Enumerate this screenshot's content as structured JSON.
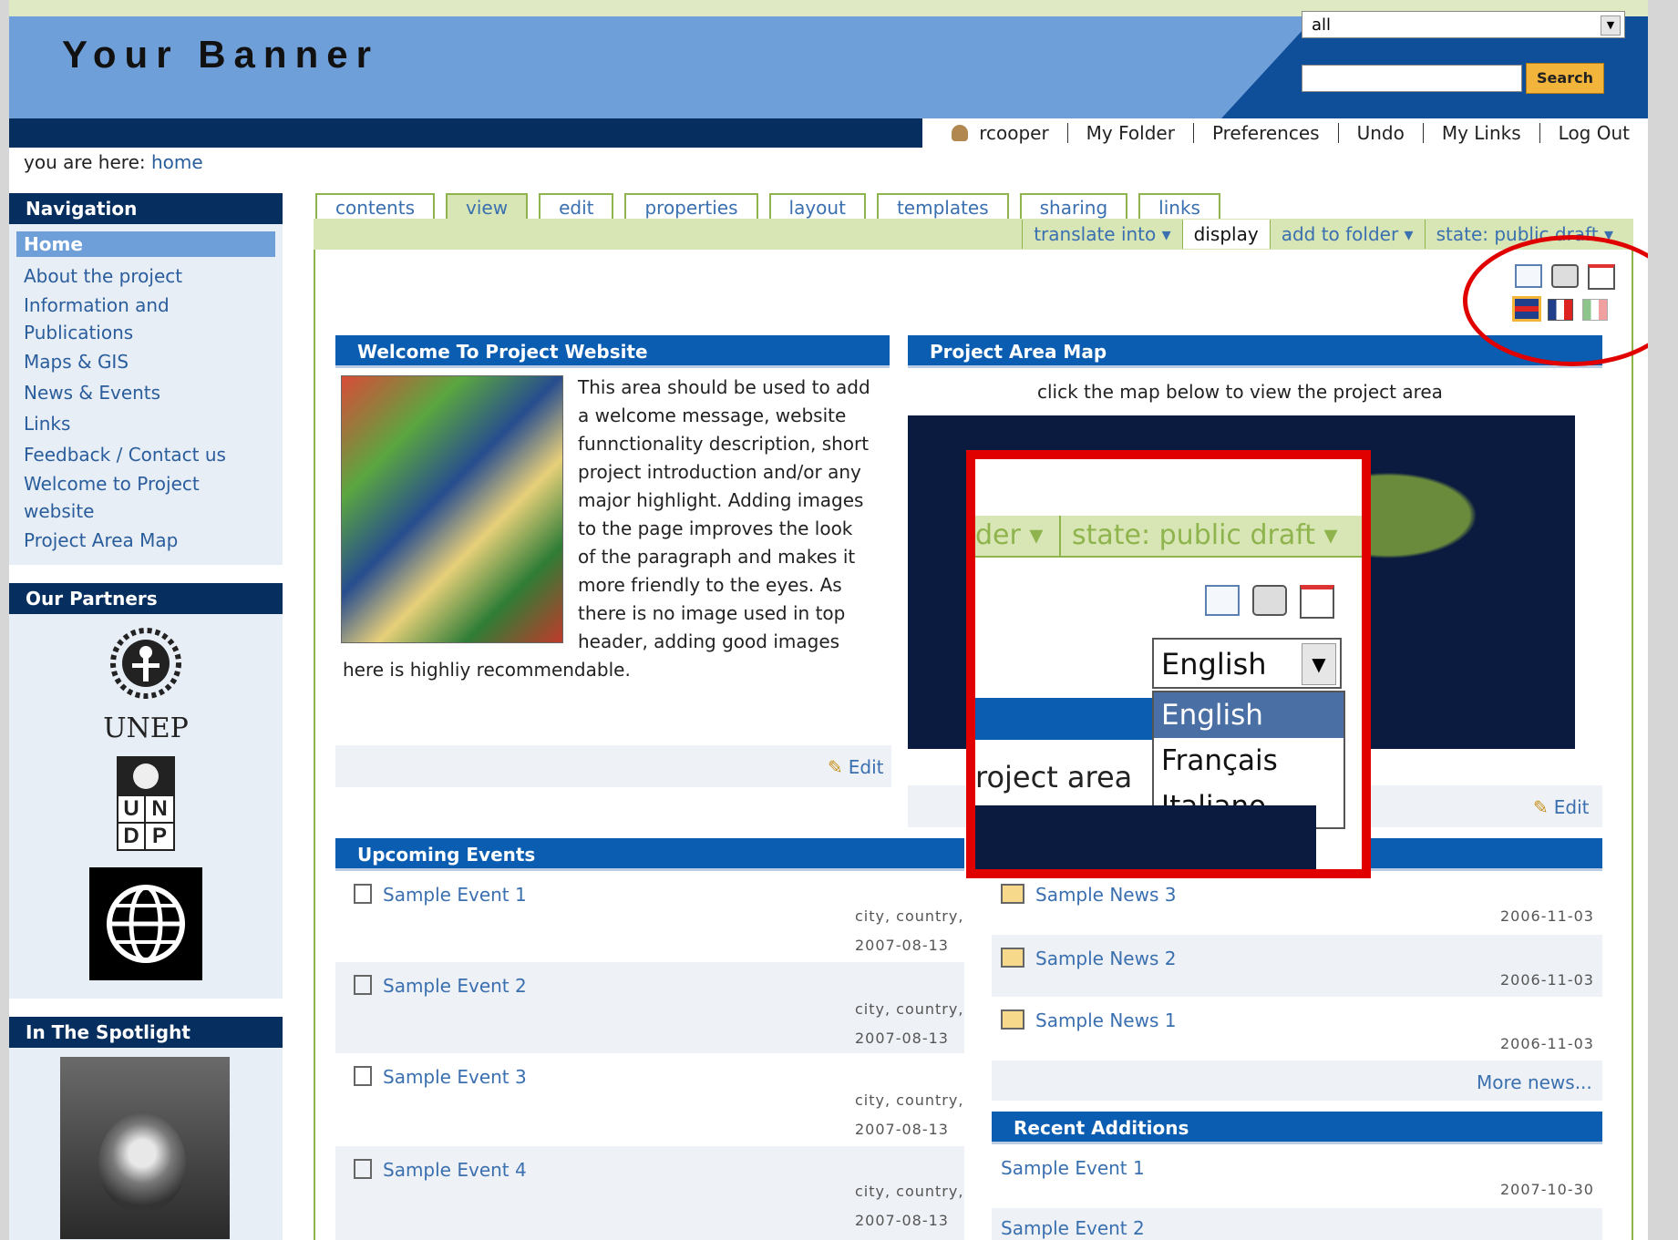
{
  "header": {
    "banner_title": "Your Banner",
    "scope_select_value": "all",
    "search_button": "Search"
  },
  "portal_actions": [
    "rcooper",
    "My Folder",
    "Preferences",
    "Undo",
    "My Links",
    "Log Out"
  ],
  "breadcrumb": {
    "label": "you are here:",
    "current": "home"
  },
  "navigation": {
    "title": "Navigation",
    "items": [
      "Home",
      "About the project",
      "Information and Publications",
      "Maps & GIS",
      "News & Events",
      "Links",
      "Feedback / Contact us",
      "Welcome to Project website",
      "Project Area Map"
    ]
  },
  "partners": {
    "title": "Our Partners",
    "unep_label": "UNEP",
    "undp_letters": [
      "U",
      "N",
      "D",
      "P"
    ]
  },
  "spotlight": {
    "title": "In The Spotlight"
  },
  "tabs": [
    "contents",
    "view",
    "edit",
    "properties",
    "layout",
    "templates",
    "sharing",
    "links"
  ],
  "action_bar": [
    "translate into ▾",
    "display",
    "add to folder ▾",
    "state: public draft ▾"
  ],
  "welcome": {
    "title": "Welcome To Project Website",
    "text": "This area should be used to add a welcome message, website funnctionality description, short project introduction and/or any major  highlight. Adding images to the page improves the look of the paragraph and makes it more friendly to the eyes. As there is no image used in top header, adding good images here is highliy recommendable.",
    "edit": "Edit"
  },
  "map_portlet": {
    "title": "Project Area Map",
    "caption": "click the map below to view the project area",
    "edit": "Edit"
  },
  "events": {
    "title": "Upcoming Events",
    "items": [
      {
        "name": "Sample Event 1",
        "location": "city, country,",
        "date": "2007-08-13"
      },
      {
        "name": "Sample Event 2",
        "location": "city, country,",
        "date": "2007-08-13"
      },
      {
        "name": "Sample Event 3",
        "location": "city, country,",
        "date": "2007-08-13"
      },
      {
        "name": "Sample Event 4",
        "location": "city, country,",
        "date": "2007-08-13"
      }
    ]
  },
  "news": {
    "items": [
      {
        "name": "Sample News 3",
        "date": "2006-11-03"
      },
      {
        "name": "Sample News 2",
        "date": "2006-11-03"
      },
      {
        "name": "Sample News 1",
        "date": "2006-11-03"
      }
    ],
    "more": "More news..."
  },
  "recent": {
    "title": "Recent Additions",
    "items": [
      {
        "name": "Sample Event 1",
        "date": "2007-10-30"
      },
      {
        "name": "Sample Event 2",
        "date": ""
      }
    ]
  },
  "zoom_callout": {
    "bar_left": "der ▾",
    "bar_state": "state: public draft ▾",
    "selected_language": "English",
    "language_options": [
      "English",
      "Français",
      "Italiano"
    ],
    "caption_fragment": "roject area"
  },
  "colors": {
    "annotation": "#e00000",
    "portlet_header": "#0a5db1",
    "nav_header": "#062e5e",
    "tab_border": "#8fb44e"
  }
}
